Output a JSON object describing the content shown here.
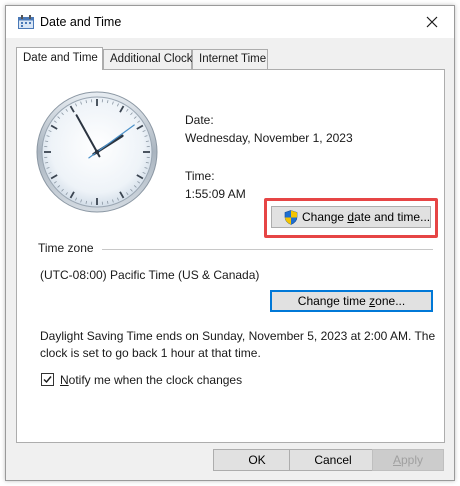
{
  "window": {
    "title": "Date and Time",
    "close_glyph": "✕"
  },
  "tabs": [
    {
      "label": "Date and Time",
      "active": true
    },
    {
      "label": "Additional Clocks",
      "active": false
    },
    {
      "label": "Internet Time",
      "active": false
    }
  ],
  "clock": {
    "hour": 1,
    "minute": 55,
    "second": 9
  },
  "date": {
    "label": "Date:",
    "value": "Wednesday, November 1, 2023"
  },
  "time": {
    "label": "Time:",
    "value": "1:55:09 AM"
  },
  "buttons": {
    "change_date_time_pre": "Change ",
    "change_date_time_mnemonic": "d",
    "change_date_time_post": "ate and time...",
    "change_time_zone_pre": "Change time ",
    "change_time_zone_mnemonic": "z",
    "change_time_zone_post": "one...",
    "ok": "OK",
    "cancel": "Cancel",
    "apply_mnemonic": "A",
    "apply_post": "pply"
  },
  "time_zone": {
    "header": "Time zone",
    "value": "(UTC-08:00) Pacific Time (US & Canada)"
  },
  "dst": {
    "line1": "Daylight Saving Time ends on Sunday, November 5, 2023 at 2:00 AM. The",
    "line2": "clock is set to go back 1 hour at that time."
  },
  "notify": {
    "checked": true,
    "label_mnemonic": "N",
    "label_post": "otify me when the clock changes"
  },
  "colors": {
    "highlight": "#e64545",
    "focus": "#0078d7",
    "shield_blue": "#1f6fd1",
    "shield_yellow": "#f5c400"
  },
  "icons": {
    "title": "date-time-icon",
    "close": "close-icon",
    "shield": "uac-shield-icon",
    "check": "checkmark-icon"
  }
}
